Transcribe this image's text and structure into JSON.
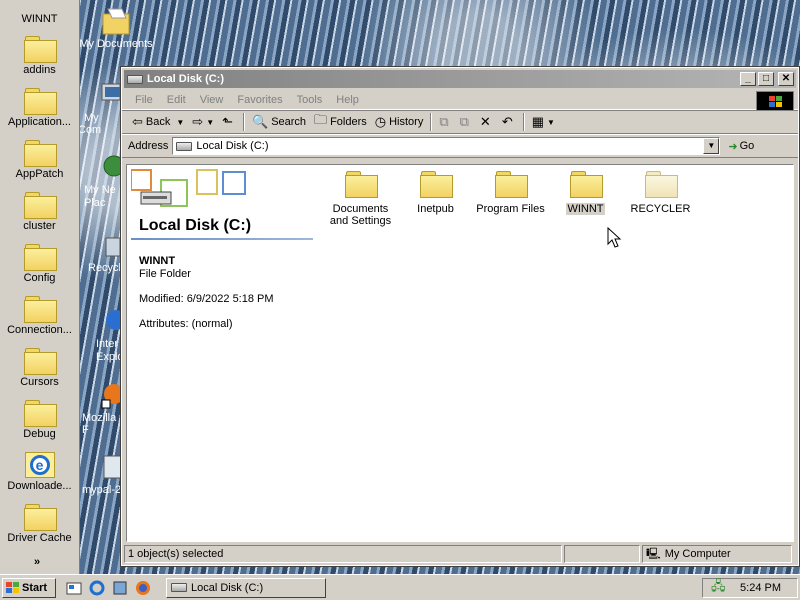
{
  "folder_bar": {
    "title": "WINNT",
    "items": [
      {
        "label": "addins",
        "icon": "folder-icon"
      },
      {
        "label": "Application...",
        "icon": "folder-icon"
      },
      {
        "label": "AppPatch",
        "icon": "folder-icon"
      },
      {
        "label": "cluster",
        "icon": "folder-icon"
      },
      {
        "label": "Config",
        "icon": "folder-icon"
      },
      {
        "label": "Connection...",
        "icon": "folder-icon"
      },
      {
        "label": "Cursors",
        "icon": "folder-icon"
      },
      {
        "label": "Debug",
        "icon": "folder-icon"
      },
      {
        "label": "Downloade...",
        "icon": "ie-folder-icon"
      },
      {
        "label": "Driver Cache",
        "icon": "folder-icon"
      }
    ],
    "more_label": "»"
  },
  "desktop_icons": [
    {
      "label": "My Documents",
      "icon": "my-documents-icon"
    },
    {
      "label": "My Com",
      "icon": "my-computer-icon"
    },
    {
      "label": "My Ne Plac",
      "icon": "network-places-icon"
    },
    {
      "label": "Recycl",
      "icon": "recycle-bin-icon"
    },
    {
      "label": "Inter Explo",
      "icon": "internet-explorer-icon"
    },
    {
      "label": "Mozilla F",
      "icon": "firefox-icon"
    },
    {
      "label": "mypal-2",
      "icon": "mypal-icon"
    }
  ],
  "window": {
    "title": "Local Disk (C:)",
    "menu": [
      "File",
      "Edit",
      "View",
      "Favorites",
      "Tools",
      "Help"
    ],
    "toolbar": {
      "back": "Back",
      "search": "Search",
      "folders": "Folders",
      "history": "History"
    },
    "address": {
      "label": "Address",
      "value": "Local Disk (C:)",
      "go": "Go"
    },
    "left_pane": {
      "title": "Local Disk (C:)",
      "selected_name": "WINNT",
      "selected_type": "File Folder",
      "modified": "Modified: 6/9/2022 5:18 PM",
      "attributes": "Attributes: (normal)"
    },
    "files": [
      {
        "label": "Documents and Settings",
        "selected": false
      },
      {
        "label": "Inetpub",
        "selected": false
      },
      {
        "label": "Program Files",
        "selected": false
      },
      {
        "label": "WINNT",
        "selected": true
      },
      {
        "label": "RECYCLER",
        "selected": false
      }
    ],
    "status": {
      "left": "1 object(s) selected",
      "zone": "My Computer"
    }
  },
  "taskbar": {
    "start": "Start",
    "task": "Local Disk (C:)",
    "clock": "5:24 PM"
  }
}
